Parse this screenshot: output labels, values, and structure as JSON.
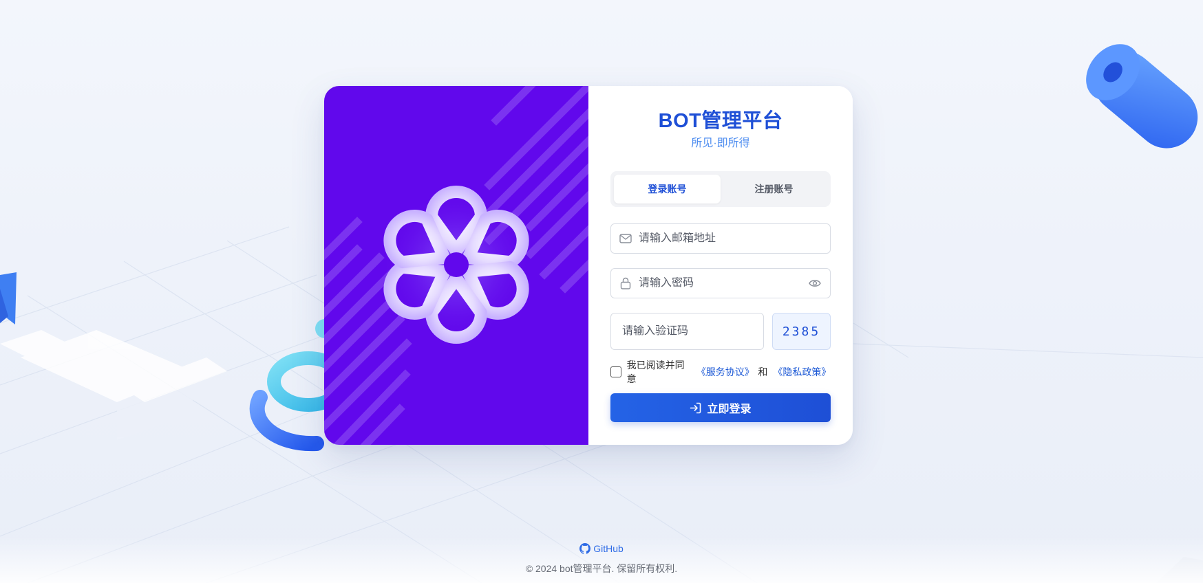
{
  "brand": {
    "title": "BOT管理平台",
    "subtitle": "所见·即所得"
  },
  "tabs": [
    {
      "label": "登录账号",
      "active": true
    },
    {
      "label": "注册账号",
      "active": false
    }
  ],
  "form": {
    "email_placeholder": "请输入邮箱地址",
    "email_value": "",
    "password_placeholder": "请输入密码",
    "password_value": "",
    "captcha_placeholder": "请输入验证码",
    "captcha_value": "",
    "captcha_code": "2385"
  },
  "agreement": {
    "checked": false,
    "text": "我已阅读并同意",
    "service_link": "《服务协议》",
    "and": "和",
    "privacy_link": "《隐私政策》"
  },
  "login_button": {
    "label": "立即登录",
    "icon": "login-icon"
  },
  "footer": {
    "github_label": "GitHub",
    "copyright": "© 2024 bot管理平台. 保留所有权利."
  },
  "colors": {
    "accent": "#1e4fd6",
    "panel_purple": "#6108ec",
    "link": "#1e5ad6"
  },
  "icons": {
    "email": "mail-icon",
    "password": "lock-icon",
    "reveal": "eye-icon",
    "github": "github-icon",
    "logo": "flower-logo"
  }
}
